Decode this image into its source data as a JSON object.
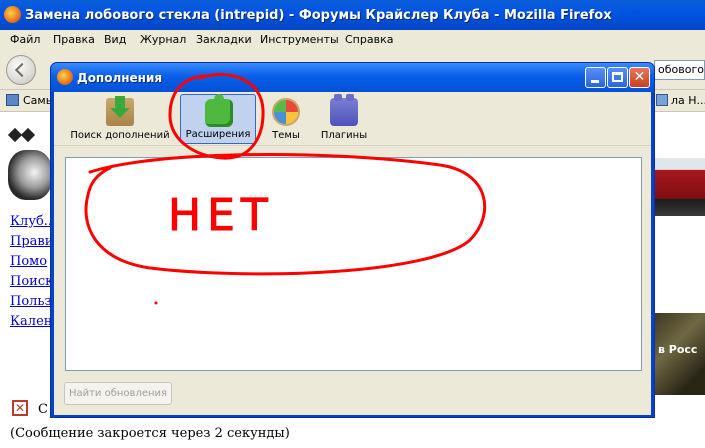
{
  "browser": {
    "title": "Замена лобового стекла (intrepid) - Форумы Крайслер Клуба - Mozilla Firefox",
    "menu": [
      "Файл",
      "Правка",
      "Вид",
      "Журнал",
      "Закладки",
      "Инструменты",
      "Справка"
    ],
    "url_fragment": "обового сте",
    "bookmark_left": "Самы",
    "bookmark_right": "ла Н..."
  },
  "page": {
    "links": [
      "Клуб...",
      "Прави",
      "Помо",
      "Поиск",
      "Польз",
      "Кален"
    ],
    "promo_text": "в Росс",
    "error_label": "С",
    "close_notice": "(Сообщение закроется через 2 секунды)"
  },
  "dialog": {
    "title": "Дополнения",
    "tabs": [
      {
        "label": "Поиск дополнений",
        "icon": "download-package-icon",
        "selected": false
      },
      {
        "label": "Расширения",
        "icon": "puzzle-piece-icon",
        "selected": true
      },
      {
        "label": "Темы",
        "icon": "palette-icon",
        "selected": false
      },
      {
        "label": "Плагины",
        "icon": "plugin-block-icon",
        "selected": false
      }
    ],
    "find_updates_label": "Найти обновления",
    "find_updates_enabled": false
  },
  "annotation": {
    "text": "НЕТ",
    "color": "#ff0000"
  }
}
